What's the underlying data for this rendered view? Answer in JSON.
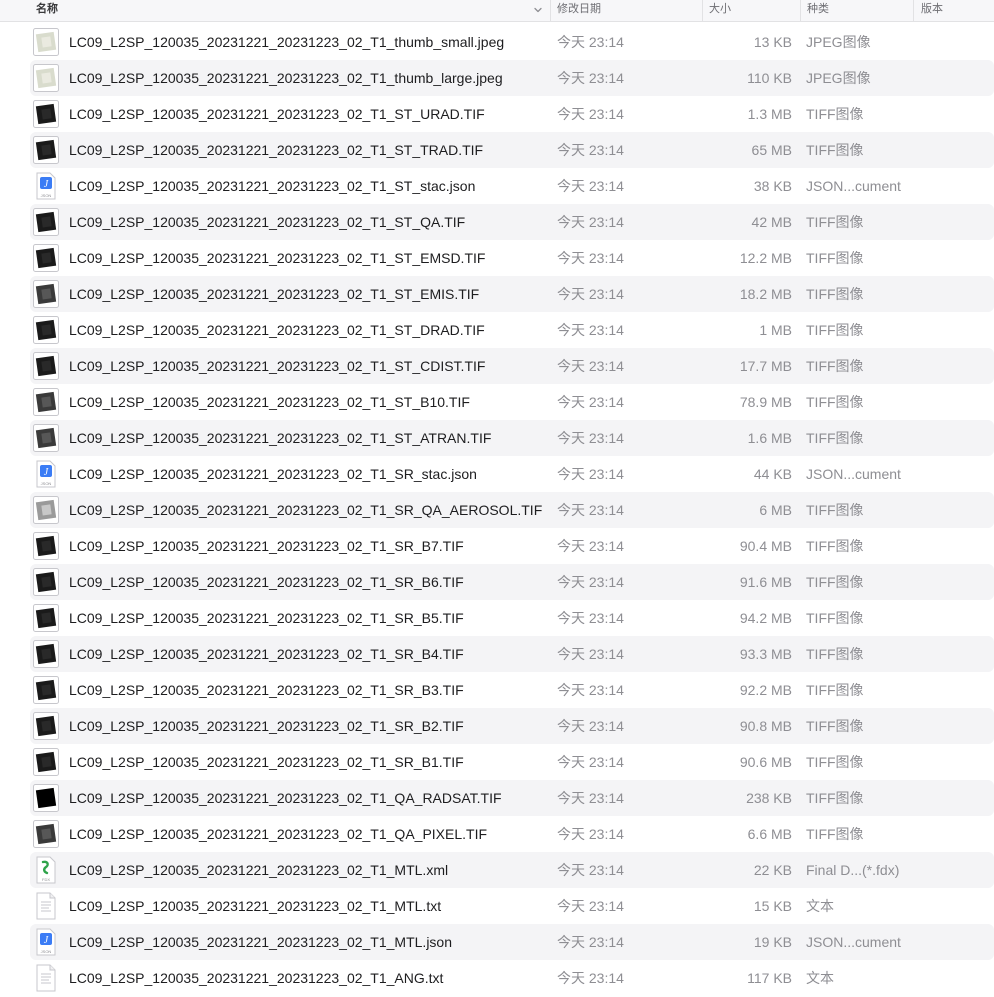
{
  "columns": {
    "name": "名称",
    "date": "修改日期",
    "size": "大小",
    "kind": "种类",
    "version": "版本"
  },
  "files": [
    {
      "name": "LC09_L2SP_120035_20231221_20231223_02_T1_thumb_small.jpeg",
      "date": "今天 23:14",
      "size": "13 KB",
      "kind": "JPEG图像",
      "icon": "jpeg-thumb-icon"
    },
    {
      "name": "LC09_L2SP_120035_20231221_20231223_02_T1_thumb_large.jpeg",
      "date": "今天 23:14",
      "size": "110 KB",
      "kind": "JPEG图像",
      "icon": "jpeg-thumb-icon"
    },
    {
      "name": "LC09_L2SP_120035_20231221_20231223_02_T1_ST_URAD.TIF",
      "date": "今天 23:14",
      "size": "1.3 MB",
      "kind": "TIFF图像",
      "icon": "tiff-dark-icon"
    },
    {
      "name": "LC09_L2SP_120035_20231221_20231223_02_T1_ST_TRAD.TIF",
      "date": "今天 23:14",
      "size": "65 MB",
      "kind": "TIFF图像",
      "icon": "tiff-dark-icon"
    },
    {
      "name": "LC09_L2SP_120035_20231221_20231223_02_T1_ST_stac.json",
      "date": "今天 23:14",
      "size": "38 KB",
      "kind": "JSON...cument",
      "icon": "json-icon"
    },
    {
      "name": "LC09_L2SP_120035_20231221_20231223_02_T1_ST_QA.TIF",
      "date": "今天 23:14",
      "size": "42 MB",
      "kind": "TIFF图像",
      "icon": "tiff-dark-icon"
    },
    {
      "name": "LC09_L2SP_120035_20231221_20231223_02_T1_ST_EMSD.TIF",
      "date": "今天 23:14",
      "size": "12.2 MB",
      "kind": "TIFF图像",
      "icon": "tiff-dark-icon"
    },
    {
      "name": "LC09_L2SP_120035_20231221_20231223_02_T1_ST_EMIS.TIF",
      "date": "今天 23:14",
      "size": "18.2 MB",
      "kind": "TIFF图像",
      "icon": "tiff-gray-icon"
    },
    {
      "name": "LC09_L2SP_120035_20231221_20231223_02_T1_ST_DRAD.TIF",
      "date": "今天 23:14",
      "size": "1 MB",
      "kind": "TIFF图像",
      "icon": "tiff-dark-icon"
    },
    {
      "name": "LC09_L2SP_120035_20231221_20231223_02_T1_ST_CDIST.TIF",
      "date": "今天 23:14",
      "size": "17.7 MB",
      "kind": "TIFF图像",
      "icon": "tiff-dark-icon"
    },
    {
      "name": "LC09_L2SP_120035_20231221_20231223_02_T1_ST_B10.TIF",
      "date": "今天 23:14",
      "size": "78.9 MB",
      "kind": "TIFF图像",
      "icon": "tiff-gray-icon"
    },
    {
      "name": "LC09_L2SP_120035_20231221_20231223_02_T1_ST_ATRAN.TIF",
      "date": "今天 23:14",
      "size": "1.6 MB",
      "kind": "TIFF图像",
      "icon": "tiff-gray-icon"
    },
    {
      "name": "LC09_L2SP_120035_20231221_20231223_02_T1_SR_stac.json",
      "date": "今天 23:14",
      "size": "44 KB",
      "kind": "JSON...cument",
      "icon": "json-icon"
    },
    {
      "name": "LC09_L2SP_120035_20231221_20231223_02_T1_SR_QA_AEROSOL.TIF",
      "date": "今天 23:14",
      "size": "6 MB",
      "kind": "TIFF图像",
      "icon": "tiff-light-icon"
    },
    {
      "name": "LC09_L2SP_120035_20231221_20231223_02_T1_SR_B7.TIF",
      "date": "今天 23:14",
      "size": "90.4 MB",
      "kind": "TIFF图像",
      "icon": "tiff-dark-icon"
    },
    {
      "name": "LC09_L2SP_120035_20231221_20231223_02_T1_SR_B6.TIF",
      "date": "今天 23:14",
      "size": "91.6 MB",
      "kind": "TIFF图像",
      "icon": "tiff-dark-icon"
    },
    {
      "name": "LC09_L2SP_120035_20231221_20231223_02_T1_SR_B5.TIF",
      "date": "今天 23:14",
      "size": "94.2 MB",
      "kind": "TIFF图像",
      "icon": "tiff-dark-icon"
    },
    {
      "name": "LC09_L2SP_120035_20231221_20231223_02_T1_SR_B4.TIF",
      "date": "今天 23:14",
      "size": "93.3 MB",
      "kind": "TIFF图像",
      "icon": "tiff-dark-icon"
    },
    {
      "name": "LC09_L2SP_120035_20231221_20231223_02_T1_SR_B3.TIF",
      "date": "今天 23:14",
      "size": "92.2 MB",
      "kind": "TIFF图像",
      "icon": "tiff-dark-icon"
    },
    {
      "name": "LC09_L2SP_120035_20231221_20231223_02_T1_SR_B2.TIF",
      "date": "今天 23:14",
      "size": "90.8 MB",
      "kind": "TIFF图像",
      "icon": "tiff-dark-icon"
    },
    {
      "name": "LC09_L2SP_120035_20231221_20231223_02_T1_SR_B1.TIF",
      "date": "今天 23:14",
      "size": "90.6 MB",
      "kind": "TIFF图像",
      "icon": "tiff-dark-icon"
    },
    {
      "name": "LC09_L2SP_120035_20231221_20231223_02_T1_QA_RADSAT.TIF",
      "date": "今天 23:14",
      "size": "238 KB",
      "kind": "TIFF图像",
      "icon": "tiff-black-icon"
    },
    {
      "name": "LC09_L2SP_120035_20231221_20231223_02_T1_QA_PIXEL.TIF",
      "date": "今天 23:14",
      "size": "6.6 MB",
      "kind": "TIFF图像",
      "icon": "tiff-gray-icon"
    },
    {
      "name": "LC09_L2SP_120035_20231221_20231223_02_T1_MTL.xml",
      "date": "今天 23:14",
      "size": "22 KB",
      "kind": "Final D...(*.fdx)",
      "icon": "fdx-icon"
    },
    {
      "name": "LC09_L2SP_120035_20231221_20231223_02_T1_MTL.txt",
      "date": "今天 23:14",
      "size": "15 KB",
      "kind": "文本",
      "icon": "text-document-icon"
    },
    {
      "name": "LC09_L2SP_120035_20231221_20231223_02_T1_MTL.json",
      "date": "今天 23:14",
      "size": "19 KB",
      "kind": "JSON...cument",
      "icon": "json-icon"
    },
    {
      "name": "LC09_L2SP_120035_20231221_20231223_02_T1_ANG.txt",
      "date": "今天 23:14",
      "size": "117 KB",
      "kind": "文本",
      "icon": "text-document-icon"
    }
  ],
  "colors": {
    "row_alt": "#f4f4f6",
    "header_bg": "#f7f7f9",
    "json_blue": "#3b7cf5",
    "fdx_green": "#2fa34a"
  }
}
